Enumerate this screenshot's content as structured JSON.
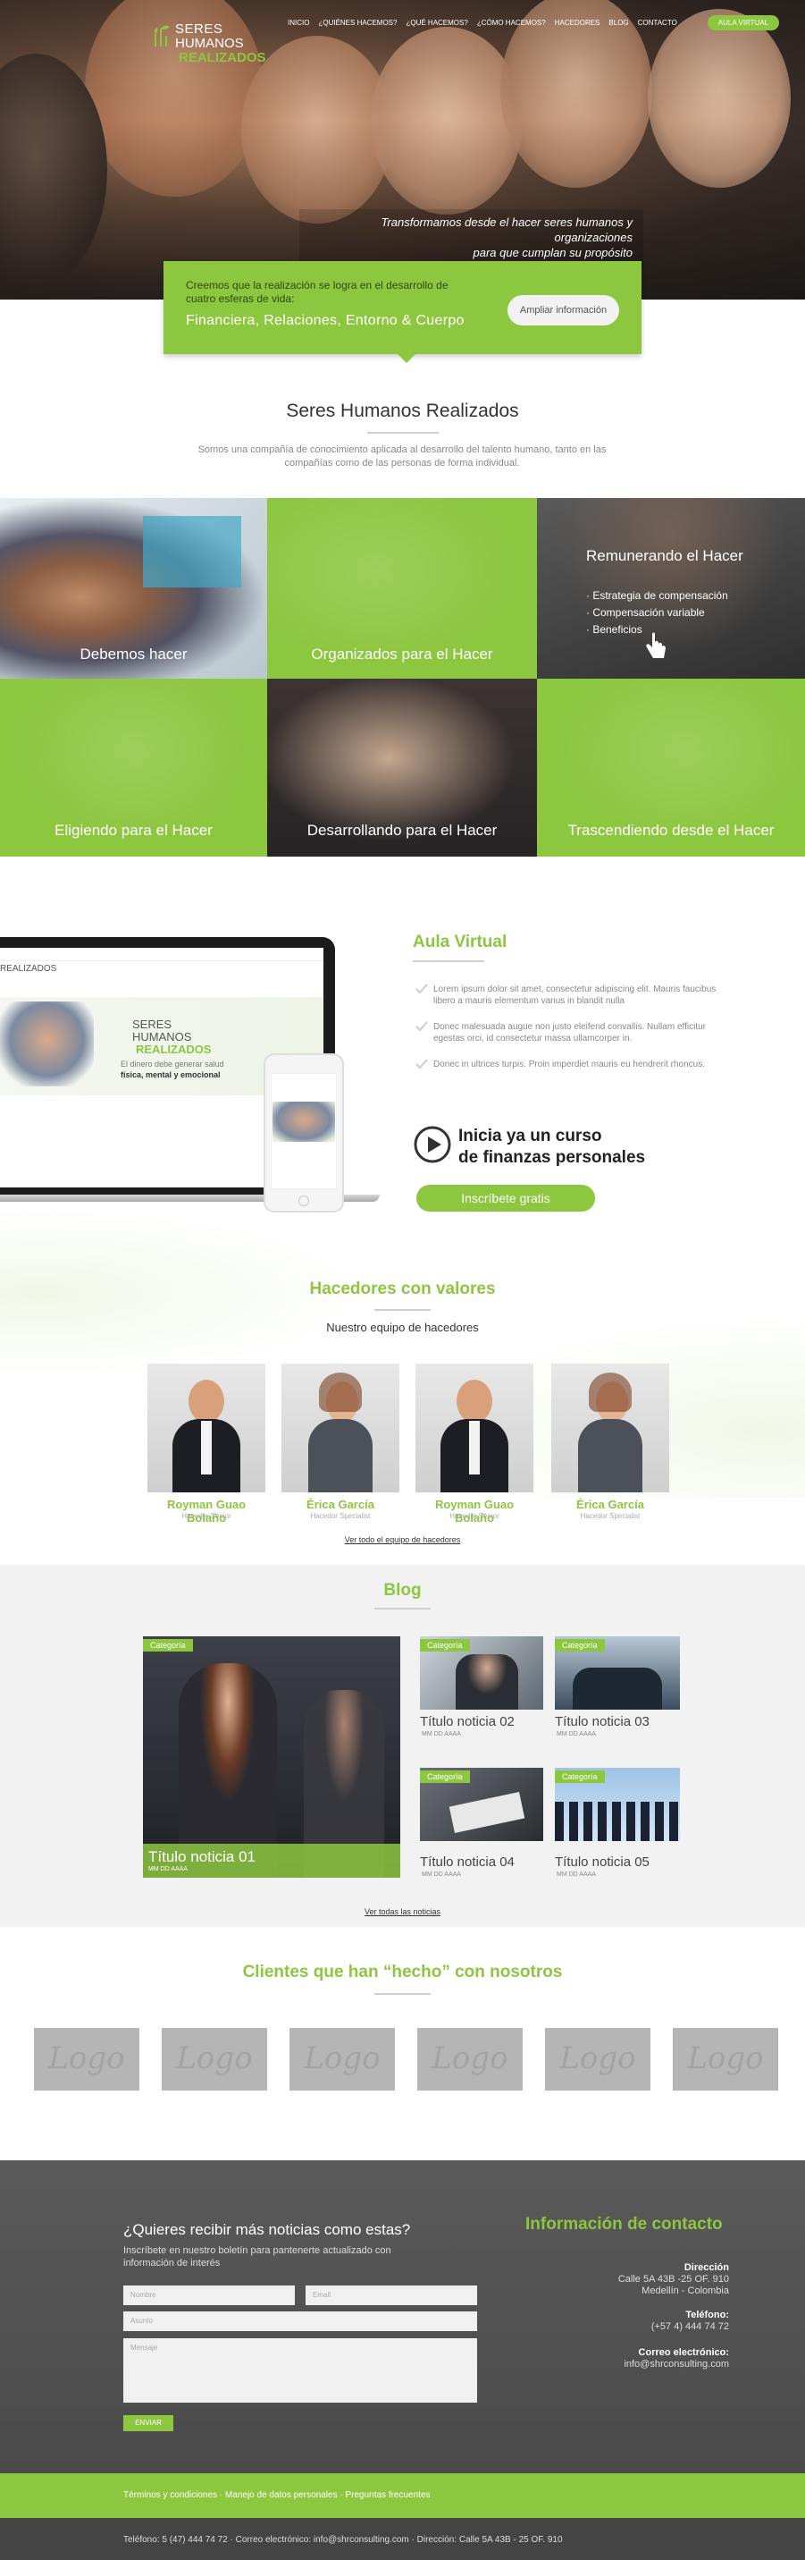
{
  "brand": {
    "logo_line1": "SERES",
    "logo_line2": "HUMANOS",
    "logo_line3": "REALIZADOS"
  },
  "nav": {
    "items": [
      "INICIO",
      "¿QUIÉNES HACEMOS?",
      "¿QUÉ HACEMOS?",
      "¿CÓMO HACEMOS?",
      "HACEDORES",
      "BLOG",
      "CONTACTO"
    ],
    "cta": "AULA VIRTUAL"
  },
  "hero": {
    "caption_line1": "Transformamos desde el hacer seres humanos y organizaciones",
    "caption_line2": "para que cumplan su propósito"
  },
  "intro_card": {
    "text": "Creemos que la realización se logra en el desarrollo de cuatro esferas de vida:",
    "spheres": "Financiera, Relaciones, Entorno & Cuerpo",
    "button": "Ampliar información"
  },
  "about": {
    "title": "Seres Humanos Realizados",
    "text": "Somos una compañía de conocimiento aplicada al desarrollo del talento humano, tanto en las compañías como de las personas de forma individual."
  },
  "tiles": [
    {
      "label": "Debemos hacer"
    },
    {
      "label": "Organizados para el Hacer"
    },
    {
      "label": "Remunerando el Hacer",
      "items": [
        "· Estrategia de compensación",
        "· Compensación variable",
        "· Beneficios"
      ]
    },
    {
      "label": "Eligiendo para el Hacer"
    },
    {
      "label": "Desarrollando para el Hacer"
    },
    {
      "label": "Trascendiendo desde el Hacer"
    }
  ],
  "aula": {
    "title": "Aula Virtual",
    "items": [
      "Lorem ipsum dolor sit amet, consectetur adipiscing elit. Mauris faucibus libero a mauris elementum varius in blandit nulla",
      "Donec malesuada augue non justo eleifend convallis. Nullam efficitur egestas orci, id consectetur massa ullamcorper in.",
      "Donec in ultrices turpis. Proin imperdiet mauris eu hendrerit rhoncus."
    ],
    "course_line1": "Inicia ya un curso",
    "course_line2": "de finanzas personales",
    "button": "Inscríbete gratis",
    "screen": {
      "logo1": "SERES",
      "logo2": "HUMANOS",
      "logo3": "REALIZADOS",
      "text1": "El dinero debe generar salud",
      "text2": "física, mental y emocional"
    }
  },
  "team": {
    "title": "Hacedores con valores",
    "subtitle": "Nuestro equipo de hacedores",
    "members": [
      {
        "name": "Royman Guao Bolaño",
        "role": "Hacedor Senior"
      },
      {
        "name": "Érica García",
        "role": "Hacedor Specialist"
      },
      {
        "name": "Royman Guao Bolaño",
        "role": "Hacedor Senior"
      },
      {
        "name": "Érica García",
        "role": "Hacedor Specialist"
      }
    ],
    "link": "Ver todo el equipo de hacedores"
  },
  "blog": {
    "title": "Blog",
    "category": "Categoría",
    "posts": [
      {
        "title": "Título noticia 01",
        "date": "MM DD AAAA"
      },
      {
        "title": "Título noticia 02",
        "date": "MM DD AAAA"
      },
      {
        "title": "Título noticia 03",
        "date": "MM DD AAAA"
      },
      {
        "title": "Título noticia 04",
        "date": "MM DD AAAA"
      },
      {
        "title": "Título noticia 05",
        "date": "MM DD AAAA"
      }
    ],
    "link": "Ver todas las noticias"
  },
  "clients": {
    "title": "Clientes que han “hecho” con nosotros",
    "logos": [
      "Logo",
      "Logo",
      "Logo",
      "Logo",
      "Logo",
      "Logo"
    ]
  },
  "newsletter": {
    "title": "¿Quieres recibir más noticias como estas?",
    "text": "Inscríbete en nuestro boletín para pantenerte actualizado con información de interés",
    "name_ph": "Nombre",
    "email_ph": "Email",
    "subject_ph": "Asunto",
    "message_ph": "Mensaje",
    "button": "ENVIAR"
  },
  "contact": {
    "title": "Información de contacto",
    "address_label": "Dirección",
    "address1": "Calle 5A 43B -25 OF. 910",
    "address2": "Medellín - Colombia",
    "phone_label": "Teléfono:",
    "phone": "(+57 4) 444 74 72",
    "email_label": "Correo electrónico:",
    "email": "info@shrconsulting.com"
  },
  "footer": {
    "links": "Términos y condiciones · Manejo de datos personales · Preguntas frecuentes",
    "bottom": "Teléfono: 5 (47) 444 74 72 · Correo electrónico: info@shrconsulting.com · Dirección: Calle 5A 43B - 25 OF. 910"
  },
  "colors": {
    "accent": "#8dc63f",
    "dark": "#4a4a4a",
    "light_bg": "#f2f2f2"
  }
}
